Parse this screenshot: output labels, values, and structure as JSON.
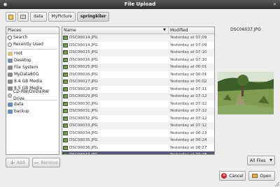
{
  "window": {
    "title": "File Upload"
  },
  "path": {
    "buttons": [
      "data",
      "MyPicture",
      "springkiler"
    ]
  },
  "places": {
    "header": "Places",
    "items": [
      {
        "label": "Search",
        "icon": "search-icon"
      },
      {
        "label": "Recently Used",
        "icon": "recent-icon"
      },
      {
        "label": "root",
        "icon": "home-folder-icon"
      },
      {
        "label": "Desktop",
        "icon": "desktop-icon"
      },
      {
        "label": "File System",
        "icon": "filesystem-icon"
      },
      {
        "label": "MyData80G",
        "icon": "drive-icon"
      },
      {
        "label": "8.4 GB Media",
        "icon": "drive-icon"
      },
      {
        "label": "8.5 GB Media",
        "icon": "drive-icon"
      },
      {
        "label": "CD-RW/DVD±RW Drive",
        "icon": "optical-drive-icon"
      },
      {
        "label": "data",
        "icon": "folder-icon"
      },
      {
        "label": "backup",
        "icon": "folder-icon"
      }
    ],
    "add_label": "Add",
    "remove_label": "Remove"
  },
  "files": {
    "header_name": "Name",
    "header_modified": "Modified",
    "rows": [
      {
        "name": "DSC06014.JPG",
        "modified": "Yesterday at 07:09"
      },
      {
        "name": "DSC06014.JPG",
        "modified": "Yesterday at 07:09"
      },
      {
        "name": "DSC06015.JPG",
        "modified": "Yesterday at 07:10"
      },
      {
        "name": "DSC06016.JPG",
        "modified": "Yesterday at 07:10"
      },
      {
        "name": "DSC06025.JPG",
        "modified": "Yesterday at 00:01"
      },
      {
        "name": "DSC06026.JPG",
        "modified": "Yesterday at 00:01"
      },
      {
        "name": "DSC06027.JPG",
        "modified": "Yesterday at 00:02"
      },
      {
        "name": "DSC06028.JPG",
        "modified": "Yesterday at 07:11"
      },
      {
        "name": "DSC06029.JPG",
        "modified": "Yesterday at 07:12"
      },
      {
        "name": "DSC06030.JPG",
        "modified": "Yesterday at 07:12"
      },
      {
        "name": "DSC06031.JPG",
        "modified": "Yesterday at 07:12"
      },
      {
        "name": "DSC06032.JPG",
        "modified": "Yesterday at 07:12"
      },
      {
        "name": "DSC06033.JPG",
        "modified": "Yesterday at 07:12"
      },
      {
        "name": "DSC06034.JPG",
        "modified": "Yesterday at 00:23"
      },
      {
        "name": "DSC06035.JPG",
        "modified": "Yesterday at 00:24"
      },
      {
        "name": "DSC06036.JPG",
        "modified": "Yesterday at 00:27"
      },
      {
        "name": "DSC06037.JPG",
        "modified": "Yesterday at 00:28"
      }
    ],
    "selected_index": 16
  },
  "preview": {
    "label": "DSC06037.JPG"
  },
  "filter": {
    "selected": "All Files"
  },
  "actions": {
    "cancel_label": "Cancel",
    "open_label": "Open"
  },
  "colors": {
    "selection": "#565a74",
    "titlebar": "#2e2e2e"
  }
}
